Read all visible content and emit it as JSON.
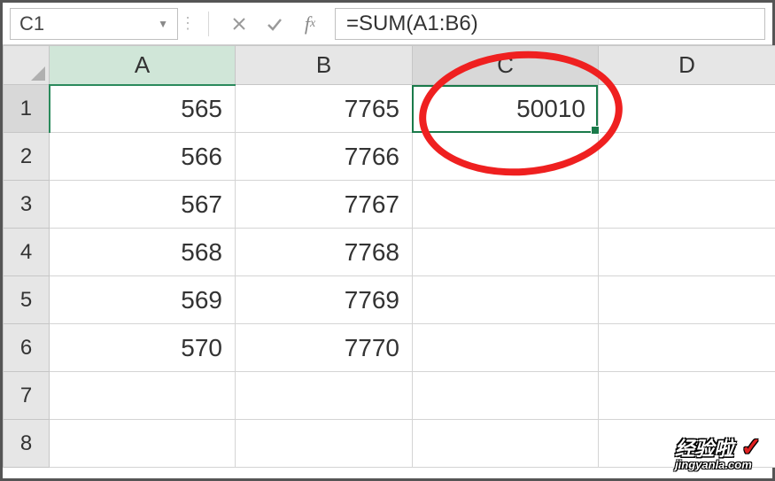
{
  "formula_bar": {
    "name_box": "C1",
    "formula": "=SUM(A1:B6)"
  },
  "columns": [
    "A",
    "B",
    "C",
    "D"
  ],
  "rows": [
    {
      "num": "1",
      "A": "565",
      "B": "7765",
      "C": "50010",
      "D": ""
    },
    {
      "num": "2",
      "A": "566",
      "B": "7766",
      "C": "",
      "D": ""
    },
    {
      "num": "3",
      "A": "567",
      "B": "7767",
      "C": "",
      "D": ""
    },
    {
      "num": "4",
      "A": "568",
      "B": "7768",
      "C": "",
      "D": ""
    },
    {
      "num": "5",
      "A": "569",
      "B": "7769",
      "C": "",
      "D": ""
    },
    {
      "num": "6",
      "A": "570",
      "B": "7770",
      "C": "",
      "D": ""
    },
    {
      "num": "7",
      "A": "",
      "B": "",
      "C": "",
      "D": ""
    },
    {
      "num": "8",
      "A": "",
      "B": "",
      "C": "",
      "D": ""
    }
  ],
  "active_cell": "C1",
  "watermark": {
    "text": "经验啦",
    "check": "✓",
    "url": "jingyanla.com"
  }
}
